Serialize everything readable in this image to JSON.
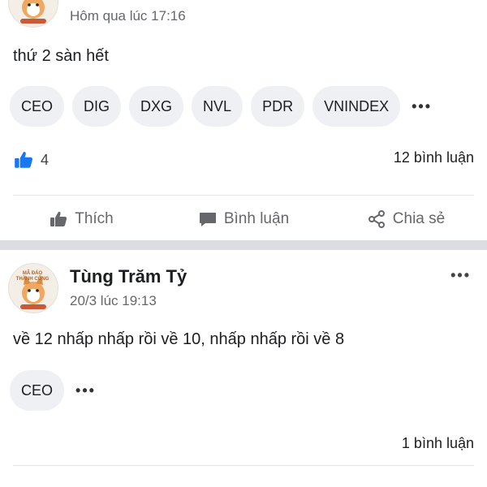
{
  "posts": [
    {
      "time": "Hôm qua lúc 17:16",
      "text": "thứ 2 sàn hết",
      "tags": [
        "CEO",
        "DIG",
        "DXG",
        "NVL",
        "PDR",
        "VNINDEX"
      ],
      "more_tags": "•••",
      "likes": "4",
      "comments": "12 bình luận"
    },
    {
      "author": "Tùng Trăm Tỷ",
      "time": "20/3 lúc 19:13",
      "text": "về 12 nhấp nhấp rồi về 10, nhấp nhấp rồi về 8",
      "tags": [
        "CEO"
      ],
      "more_tags": "•••",
      "comments": "1 bình luận",
      "more": "•••",
      "avatar_caption": "MÃ ĐÁO THÀNH CÔNG"
    }
  ],
  "actions": {
    "like": "Thích",
    "comment": "Bình luận",
    "share": "Chia sẻ"
  },
  "colors": {
    "like_blue": "#1877f2",
    "muted": "#65676b",
    "chip_bg": "#eef0f3",
    "band": "#dcdde1"
  }
}
